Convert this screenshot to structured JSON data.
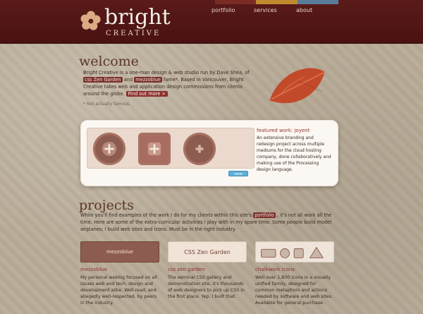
{
  "header": {
    "logo_word": "bright",
    "logo_sub": "CREATIVE",
    "bar_colors": [
      "#7a2b24",
      "#c28a2f",
      "#5b7c9a"
    ],
    "nav": [
      {
        "label": "portfolio"
      },
      {
        "label": "services"
      },
      {
        "label": "about"
      }
    ]
  },
  "welcome": {
    "title": "welcome",
    "p1": "Bright Creative is a one-man design & web studio run by Dave Shea, of",
    "link_css": "css Zen Garden",
    "and": "and",
    "link_mezz": "mezzoblue",
    "p2": "fame*. Based in Vancouver, Bright Creative takes web and application design commissions from clients around the globe.",
    "findmore": "Find out more >",
    "footnote": "* Not actually famous."
  },
  "featured": {
    "title": "featured work: joyent",
    "body": "An extensive branding and redesign project across multiple mediums for the cloud hosting company, done collaboratively and making use of the Processing design language.",
    "view_label": "view"
  },
  "projects": {
    "title": "projects",
    "p1": "While you'll find examples of the work I do for my clients within this site's",
    "portfolio_link": "portfolio",
    "p2": ", it's not all work all the time. Here are some of the extra-curricular activities I play with in my spare time. Some people build model airplanes; I build web sites and icons. Must be in the right industry."
  },
  "cards": [
    {
      "title": "mezzoblue",
      "thumb_label": "mezzoblue",
      "body": "My personal weblog focused on all issues web and tech, design and development alike. Well-read, and allegedly well-respected, by peers in the industry."
    },
    {
      "title": "css zen garden",
      "thumb_label": "CSS Zen Garden",
      "body": "The seminal CSS gallery and demonstration site, it's thousands of web designers to pick up CSS in the first place. Yep, I built that."
    },
    {
      "title": "chalkwork icons",
      "thumb_label": "",
      "body": "Well over 1,800 icons in a visually unified family, designed for common metaphors and actions needed by software and web sites. Available for general purchase."
    }
  ]
}
